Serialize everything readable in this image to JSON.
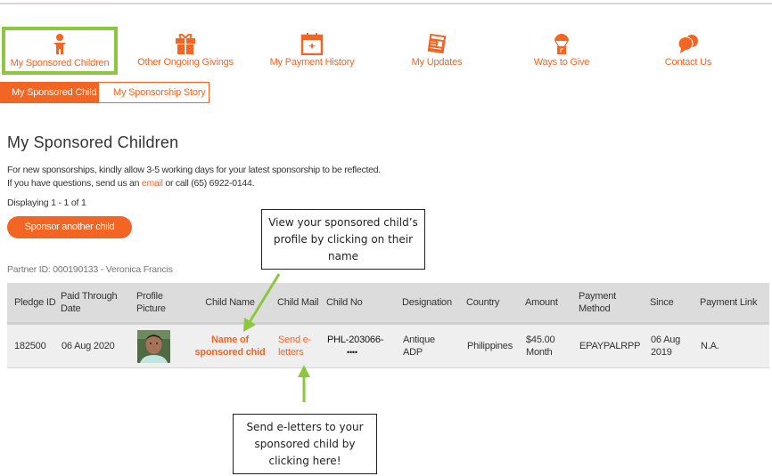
{
  "nav": {
    "items": [
      {
        "label": "My Sponsored Children",
        "icon": "child-icon",
        "active": true
      },
      {
        "label": "Other Ongoing Givings",
        "icon": "gift-icon",
        "active": false
      },
      {
        "label": "My Payment History",
        "icon": "calendar-icon",
        "active": false
      },
      {
        "label": "My Updates",
        "icon": "newspaper-icon",
        "active": false
      },
      {
        "label": "Ways to Give",
        "icon": "parachute-icon",
        "active": false
      },
      {
        "label": "Contact Us",
        "icon": "chat-bubbles-icon",
        "active": false
      }
    ],
    "accent_color": "#f26522",
    "highlight_color": "#8dc63f"
  },
  "subtabs": [
    {
      "label": "My Sponsored Child",
      "active": true
    },
    {
      "label": "My Sponsorship Story",
      "active": false
    }
  ],
  "page": {
    "title": "My Sponsored Children",
    "info_line1": "For new sponsorships, kindly allow 3-5 working days for your latest sponsorship to be reflected.",
    "info_line2_pre": "If you have questions, send us an ",
    "info_line2_link": "email",
    "info_line2_post": " or call (65) 6922-0144.",
    "displaying": "Displaying 1 - 1 of 1",
    "sponsor_button": "Sponsor another child",
    "partner": "Partner ID: 000190133 - Veronica Francis"
  },
  "table": {
    "headers": [
      "Pledge ID",
      "Paid Through Date",
      "Profile Picture",
      "Child Name",
      "Child Mail",
      "Child No",
      "Designation",
      "Country",
      "Amount",
      "Payment Method",
      "Since",
      "Payment Link"
    ],
    "rows": [
      {
        "pledge_id": "182500",
        "paid_through": "06 Aug 2020",
        "child_name": "Name of sponsored  chid",
        "child_mail": "Send e-letters",
        "child_no": "PHL-203066-",
        "child_no_masked": "••••",
        "designation": "Antique ADP",
        "country": "Philippines",
        "amount": "$45.00 Month",
        "payment_method": "EPAYPALRPP",
        "since": "06 Aug 2019",
        "payment_link": "N.A."
      }
    ]
  },
  "callouts": {
    "profile": "View your sponsored child’s profile by clicking on their name",
    "eletters": "Send e-letters to your sponsored child by clicking here!"
  }
}
